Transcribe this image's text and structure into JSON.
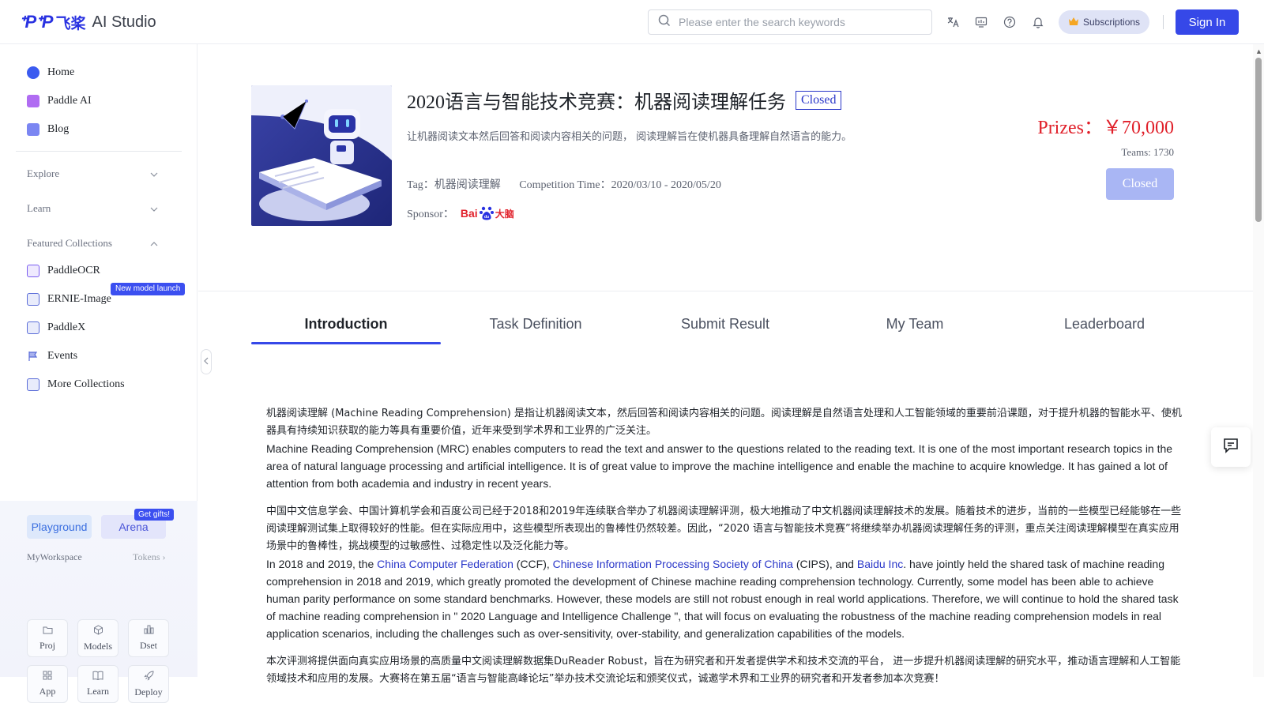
{
  "header": {
    "logo_mark": "ᐩPᐩP",
    "logo_cn": "飞桨",
    "logo_studio": "AI Studio",
    "search_placeholder": "Please enter the search keywords",
    "subscriptions_label": "Subscriptions",
    "signin_label": "Sign In",
    "icons": [
      "translate-icon",
      "monitor-icon",
      "help-icon",
      "bell-icon"
    ]
  },
  "sidebar": {
    "nav": [
      {
        "label": "Home",
        "icon": "home-icon",
        "color": "#3b5bf0"
      },
      {
        "label": "Paddle AI",
        "icon": "paddle-ai-icon",
        "color": "#a45cf0"
      },
      {
        "label": "Blog",
        "icon": "blog-icon",
        "color": "#6b7cf0"
      }
    ],
    "sections": {
      "explore": "Explore",
      "learn": "Learn",
      "featured": "Featured Collections"
    },
    "collections": [
      {
        "label": "PaddleOCR",
        "icon": "ocr-icon"
      },
      {
        "label": "ERNIE-Image",
        "icon": "image-icon"
      },
      {
        "label": "PaddleX",
        "icon": "paddlex-icon"
      },
      {
        "label": "Events",
        "icon": "flag-icon"
      },
      {
        "label": "More Collections",
        "icon": "collection-icon"
      }
    ],
    "new_badge": "New model launch",
    "workspace": {
      "playground": "Playground",
      "arena": "Arena",
      "gift": "Get gifts!",
      "title": "MyWorkspace",
      "tokens": "Tokens",
      "tiles": [
        {
          "label": "Proj",
          "icon": "folder-icon"
        },
        {
          "label": "Models",
          "icon": "cube-icon"
        },
        {
          "label": "Dset",
          "icon": "dataset-icon"
        },
        {
          "label": "App",
          "icon": "app-grid-icon"
        },
        {
          "label": "Learn",
          "icon": "book-icon"
        },
        {
          "label": "Deploy",
          "icon": "rocket-icon"
        }
      ]
    }
  },
  "competition": {
    "title": "2020语言与智能技术竞赛：机器阅读理解任务",
    "status_tag": "Closed",
    "description": "让机器阅读文本然后回答和阅读内容相关的问题， 阅读理解旨在使机器具备理解自然语言的能力。",
    "tag": "Tag：机器阅读理解",
    "time": "Competition Time：2020/03/10 - 2020/05/20",
    "sponsor_label": "Sponsor：",
    "sponsor_logo": "Bai du 大脑",
    "prize": "Prizes：￥70,000",
    "teams": "Teams: 1730",
    "button": "Closed"
  },
  "tabs": [
    "Introduction",
    "Task Definition",
    "Submit Result",
    "My Team",
    "Leaderboard"
  ],
  "content": {
    "p1_cn": "机器阅读理解 (Machine Reading Comprehension) 是指让机器阅读文本，然后回答和阅读内容相关的问题。阅读理解是自然语言处理和人工智能领域的重要前沿课题，对于提升机器的智能水平、使机器具有持续知识获取的能力等具有重要价值，近年来受到学术界和工业界的广泛关注。",
    "p1_en": "Machine Reading Comprehension (MRC) enables computers to read the text and answer to the questions related to the reading text. It is one of the most important research topics in the area of natural language processing and artificial intelligence. It is of great value to improve the machine intelligence and enable the machine to acquire knowledge. It has gained a lot of attention from both academia and industry in recent years.",
    "p2_cn": "中国中文信息学会、中国计算机学会和百度公司已经于2018和2019年连续联合举办了机器阅读理解评测，极大地推动了中文机器阅读理解技术的发展。随着技术的进步，当前的一些模型已经能够在一些阅读理解测试集上取得较好的性能。但在实际应用中，这些模型所表现出的鲁棒性仍然较差。因此，“2020 语言与智能技术竞赛”将继续举办机器阅读理解任务的评测，重点关注阅读理解模型在真实应用场景中的鲁棒性，挑战模型的过敏感性、过稳定性以及泛化能力等。",
    "p2_en_a": "In 2018 and 2019, the ",
    "link_ccf": "China Computer Federation",
    "p2_en_b": " (CCF), ",
    "link_cips": "Chinese Information Processing Society of China",
    "p2_en_c": " (CIPS), and ",
    "link_baidu": "Baidu Inc",
    "p2_en_d": ". have jointly held the shared task of machine reading comprehension in 2018 and 2019, which greatly promoted the development of Chinese machine reading comprehension technology. Currently, some model has been able to achieve human parity performance on some standard benchmarks. However, these models are still not robust enough in real world applications. Therefore, we will continue to hold the shared task of machine reading comprehension in \" 2020 Language and Intelligence Challenge \", that will focus on evaluating the robustness of the machine reading comprehension models in real application scenarios, including the challenges such as over-sensitivity, over-stability, and generalization capabilities of the models.",
    "p3_cn": "本次评测将提供面向真实应用场景的高质量中文阅读理解数据集DuReader Robust，旨在为研究者和开发者提供学术和技术交流的平台， 进一步提升机器阅读理解的研究水平，推动语言理解和人工智能领域技术和应用的发展。大赛将在第五届“语言与智能高峰论坛”举办技术交流论坛和颁奖仪式，诚邀学术界和工业界的研究者和开发者参加本次竞赛！"
  },
  "colors": {
    "brand": "#2932e1",
    "primary": "#3648e8",
    "prize": "#e0202a"
  }
}
